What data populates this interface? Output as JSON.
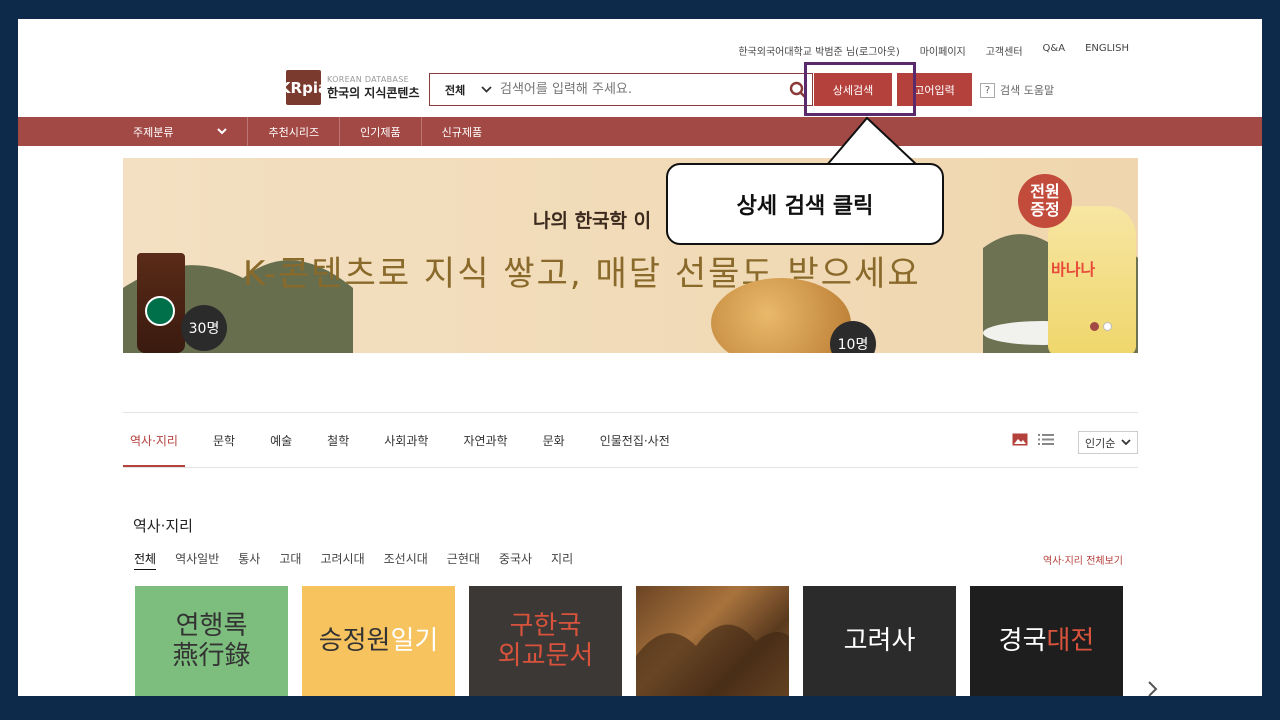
{
  "util_links": [
    "한국외국어대학교 박범준 님(로그아웃)",
    "마이페이지",
    "고객센터",
    "Q&A",
    "ENGLISH"
  ],
  "logo": {
    "mark": "KRpia",
    "sub": "KOREAN DATABASE",
    "main": "한국의 지식콘텐츠"
  },
  "search": {
    "scope": "전체",
    "placeholder": "검색어를 입력해 주세요."
  },
  "buttons": {
    "advanced": "상세검색",
    "old_korean": "고어입력"
  },
  "help": {
    "q": "?",
    "label": "검색 도움말"
  },
  "nav": [
    "주제분류",
    "추천시리즈",
    "인기제품",
    "신규제품"
  ],
  "banner": {
    "headline_top": "나의 한국학 이",
    "headline_main": "K-콘텐츠로 지식 쌓고, 매달 선물도 받으세요",
    "badge_30": "30명",
    "badge_10": "10명",
    "gift_badge": "전원\n증정",
    "milk_label": "바나나"
  },
  "callout": "상세 검색 클릭",
  "categories": [
    "역사·지리",
    "문학",
    "예술",
    "철학",
    "사회과학",
    "자연과학",
    "문화",
    "인물전집·사전"
  ],
  "sort": "인기순",
  "section": {
    "title": "역사·지리",
    "subcategories": [
      "전체",
      "역사일반",
      "통사",
      "고대",
      "고려시대",
      "조선시대",
      "근현대",
      "중국사",
      "지리"
    ],
    "view_all": "역사·지리 전체보기"
  },
  "cards": [
    {
      "line1": "연행록",
      "line2": "燕行錄",
      "bg": "#7dbd7e",
      "fg": "#333"
    },
    {
      "line1": "승정원",
      "line1b": "일기",
      "bg": "#f6c35f",
      "fg": "#333"
    },
    {
      "line1": "구한국",
      "line2": "외교문서",
      "bg": "#3b3835",
      "fg": "#d9533c"
    },
    {
      "line1": "",
      "bg": "#8a5a2e",
      "fg": "#fff"
    },
    {
      "line1": "고려사",
      "bg": "#2b2b2b",
      "fg": "#fff"
    },
    {
      "line1": "경국",
      "line1b": "대전",
      "bg": "#1e1e1e",
      "fg": "#fff"
    }
  ],
  "colors": {
    "brand": "#b5413d",
    "nav": "#a24945",
    "frame": "#0e2a4a"
  }
}
